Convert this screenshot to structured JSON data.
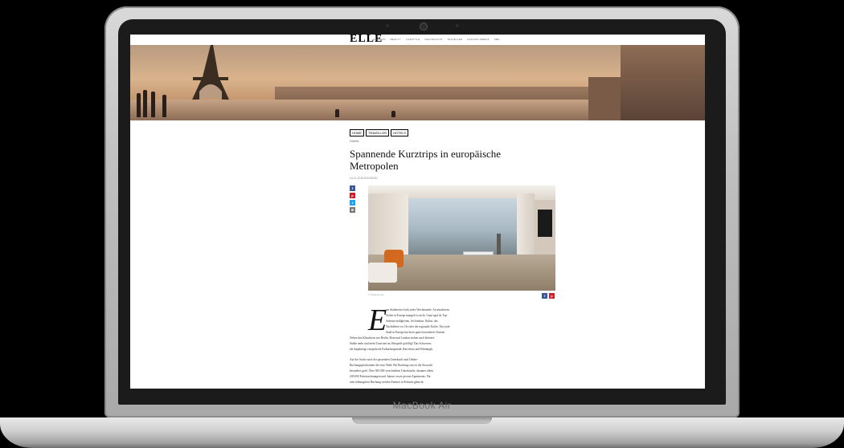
{
  "device": {
    "brand": "MacBook Air"
  },
  "site": {
    "logo": "ELLE",
    "nav": [
      "FASHION",
      "BEAUTY",
      "LIFESTYLE",
      "DECORATION",
      "TRAVELLER",
      "FASHION WEEKS",
      "SBD"
    ]
  },
  "article": {
    "breadcrumbs": [
      "HOME",
      "TRAVELLER",
      "HOTELS"
    ],
    "kicker": "Hotels",
    "title": "Spannende Kurztrips in europäische Metropolen",
    "byline": "04.11.2018 BOOKING",
    "share_icons": [
      "f",
      "p",
      "t",
      "✉"
    ],
    "photo_caption": "© booking.com",
    "dropcap": "E",
    "para1_lines": [
      "ine Städtereise lockt jedes Wochenende. An attraktiven",
      "Zielen in Europa mangelt es nicht. Ganz egal ob Top-",
      "Sehenswürdigkeiten, Architektur, Kultur, das",
      "Nachtleben vor Ort oder die regionale Küche. Fast jede",
      "Stadt in Europa hat ihren ganz besonderen Charme.",
      "Neben den Klassikern wie Berlin, Rom und London ziehen auch kleinere",
      "Städte mehr und mehr Touristen an. Beispiele gefällig? Das Schweizer,",
      "die dauphinige europäische Kulturhauptstadt, Barcelona und Edinburgh."
    ],
    "para2_lines": [
      "Auf der Suche nach der passenden Unterkunft sind Online-",
      "Buchungsplattformen die erste Wahl. Bei Booking.com ist die Auswahl",
      "besonders groß. Über 945.000 verschiedene Unterkünfte, darunter allein",
      "439.000 Ferienwohnungen und -häuser sowie private Apartments. Für",
      "eine reibungslose Buchung werden Zimmer in Echtzeit gebucht."
    ]
  },
  "colors": {
    "facebook": "#3b5998",
    "pinterest": "#cb2027",
    "twitter": "#1da1f2",
    "mail": "#777777"
  }
}
